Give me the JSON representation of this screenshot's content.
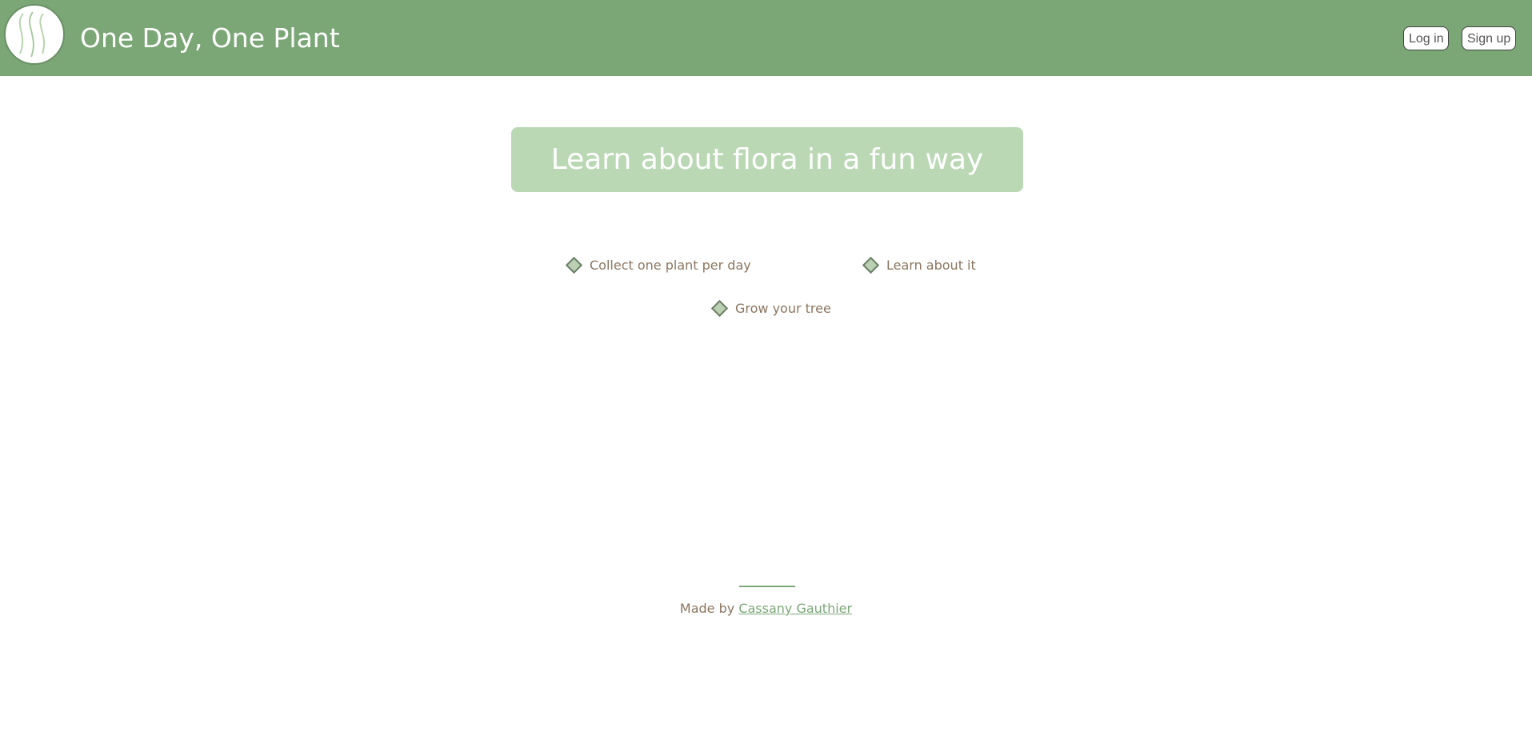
{
  "header": {
    "title": "One Day, One Plant",
    "logo_icon": "plant-logo-icon",
    "login_label": "Log in",
    "signup_label": "Sign up",
    "background_color": "#7ba776"
  },
  "hero": {
    "headline": "Learn about flora in a fun way",
    "background_color": "#bbd8b5"
  },
  "features": [
    {
      "icon": "diamond-bullet-icon",
      "label": "Collect one plant per day"
    },
    {
      "icon": "diamond-bullet-icon",
      "label": "Learn about it"
    },
    {
      "icon": "diamond-bullet-icon",
      "label": "Grow your tree"
    }
  ],
  "footer": {
    "made_by_prefix": "Made by",
    "author_name": "Cassany Gauthier",
    "link_color": "#7ba776"
  }
}
